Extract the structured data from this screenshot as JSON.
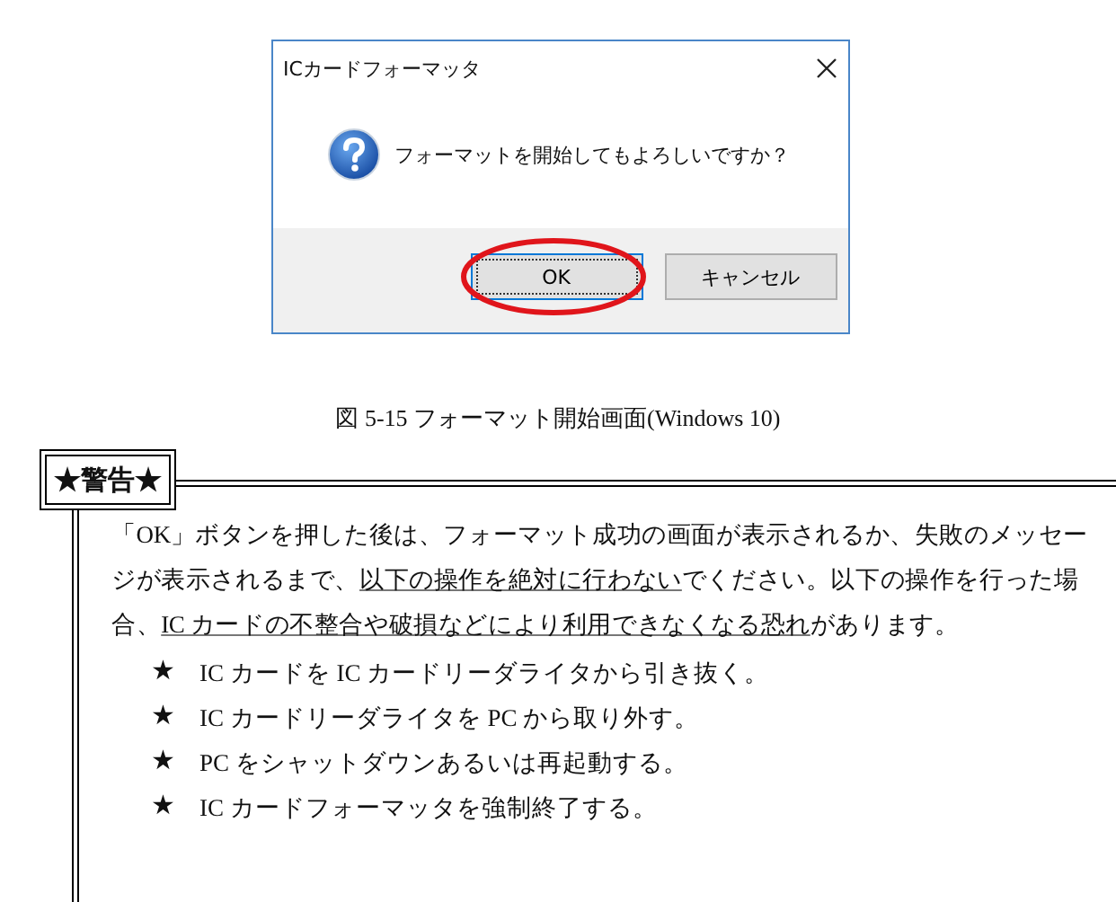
{
  "dialog": {
    "title": "ICカードフォーマッタ",
    "message": "フォーマットを開始してもよろしいですか？",
    "buttons": [
      {
        "label": "OK",
        "focused": true,
        "circled": true
      },
      {
        "label": "キャンセル",
        "focused": false,
        "circled": false
      }
    ]
  },
  "caption": "図 5-15 フォーマット開始画面(Windows 10)",
  "warning": {
    "label": "★警告★",
    "paragraph": [
      {
        "text": "「OK」ボタンを押した後は、フォーマット成功の画面が表示されるか、失敗のメッセージが表示されるまで、",
        "underline": false
      },
      {
        "text": "以下の操作を絶対に行わない",
        "underline": true
      },
      {
        "text": "でください。以下の操作を行った場合、",
        "underline": false
      },
      {
        "text": "IC カードの不整合や破損などにより利用できなくなる恐れ",
        "underline": true
      },
      {
        "text": "があります。",
        "underline": false
      }
    ],
    "items": [
      {
        "bullet": "★",
        "text": "IC カードを IC カードリーダライタから引き抜く。"
      },
      {
        "bullet": "★",
        "text": "IC カードリーダライタを PC から取り外す。"
      },
      {
        "bullet": "★",
        "text": "PC をシャットダウンあるいは再起動する。"
      },
      {
        "bullet": "★",
        "text": "IC カードフォーマッタを強制終了する。"
      }
    ]
  }
}
